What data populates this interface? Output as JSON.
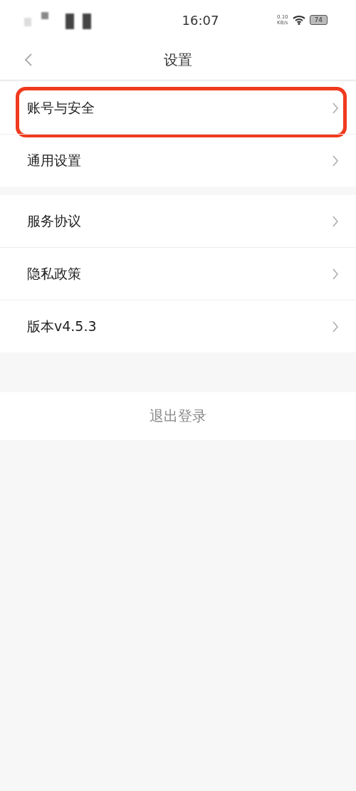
{
  "status_bar": {
    "time": "16:07",
    "net_speed": "0.10",
    "net_unit": "KB/s",
    "battery": "74"
  },
  "header": {
    "title": "设置"
  },
  "groups": [
    {
      "items": [
        {
          "label": "账号与安全",
          "highlighted": true
        },
        {
          "label": "通用设置",
          "highlighted": false
        }
      ]
    },
    {
      "items": [
        {
          "label": "服务协议",
          "highlighted": false
        },
        {
          "label": "隐私政策",
          "highlighted": false
        },
        {
          "label": "版本v4.5.3",
          "highlighted": false
        }
      ]
    }
  ],
  "logout_button": "退出登录"
}
